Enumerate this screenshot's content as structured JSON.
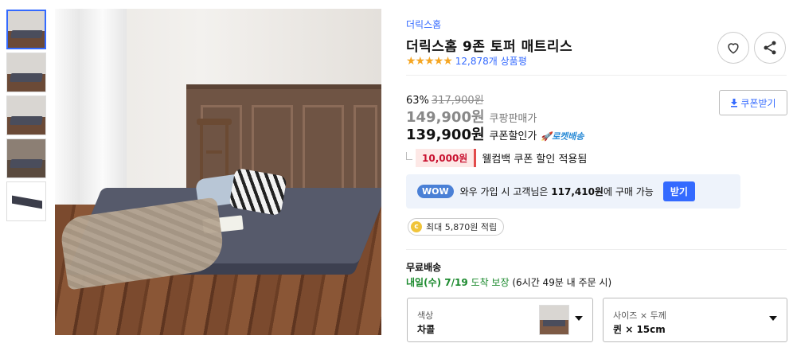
{
  "gallery": {
    "thumbnails": [
      "thumb-1",
      "thumb-2",
      "thumb-3",
      "thumb-4",
      "thumb-5"
    ],
    "active_index": 0
  },
  "product": {
    "brand": "더릭스홈",
    "title": "더릭스홈 9존 토퍼 매트리스",
    "rating_stars": "★★★★★",
    "rating_value": 4.5,
    "review_count": "12,878개 상품평"
  },
  "pricing": {
    "discount_rate": "63%",
    "original_price": "317,900원",
    "coupang_price": "149,900원",
    "coupang_price_label": "쿠팡판매가",
    "coupon_price": "139,900원",
    "coupon_price_label": "쿠폰할인가",
    "rocket_label": "로켓배송",
    "coupon_button_label": "쿠폰받기",
    "coupon_amount": "10,000원",
    "coupon_text": "웰컴백 쿠폰 할인 적용됨"
  },
  "wow": {
    "badge": "WOW",
    "text_prefix": "와우 가입 시 고객님은",
    "text_price": "117,410원",
    "text_suffix": "에 구매 가능",
    "button_label": "받기"
  },
  "cash": {
    "icon_letter": "c",
    "text": "최대 5,870원 적립"
  },
  "shipping": {
    "title": "무료배송",
    "date": "내일(수) 7/19",
    "date_suffix": "도착 보장",
    "note": "(6시간 49분 내 주문 시)"
  },
  "options": {
    "color_label": "색상",
    "color_value": "차콜",
    "size_label": "사이즈 × 두께",
    "size_value": "퀸 × 15cm"
  },
  "icons": {
    "heart": "heart-icon",
    "share": "share-icon",
    "download": "download-icon",
    "rocket": "rocket-icon",
    "caret": "caret-down-icon"
  },
  "colors": {
    "accent": "#346aff",
    "star": "#f5a623",
    "coupon_red": "#c8102e",
    "ship_green": "#1c8a2e",
    "wow_bg": "#eef3fb"
  }
}
